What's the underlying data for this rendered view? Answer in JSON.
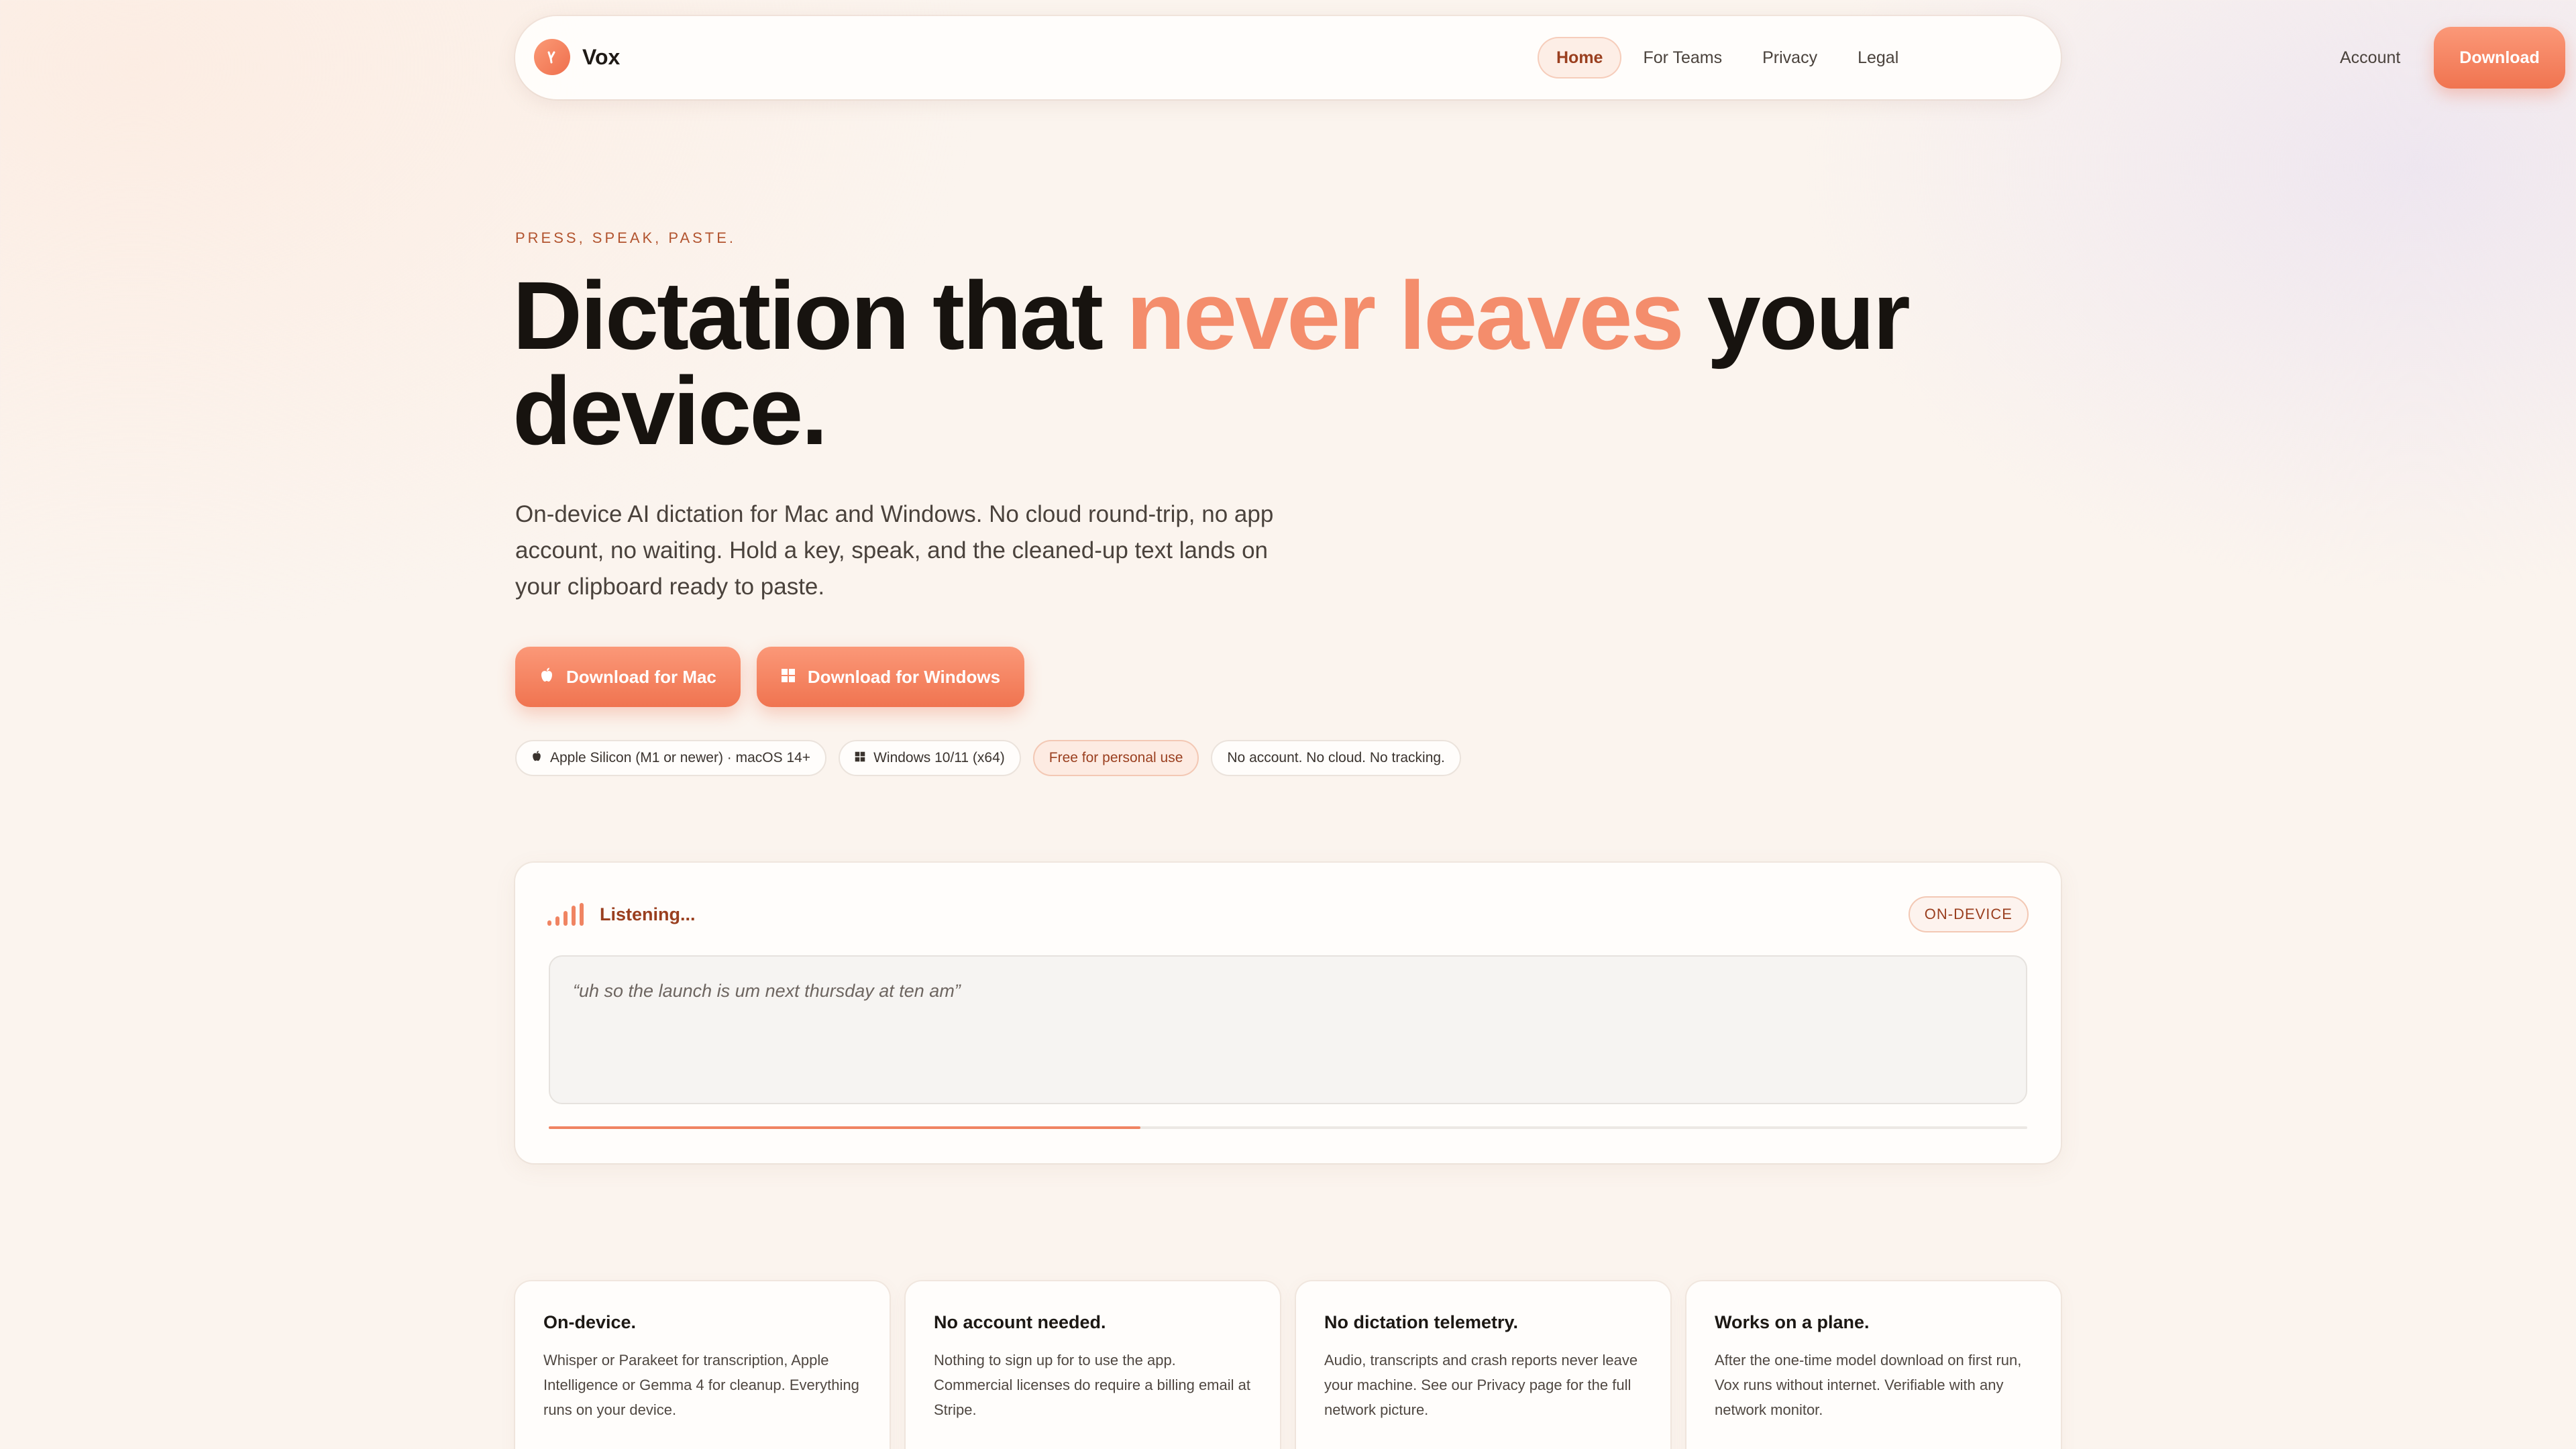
{
  "brand": {
    "name": "Vox"
  },
  "nav": {
    "links": [
      {
        "label": "Home",
        "active": true
      },
      {
        "label": "For Teams",
        "active": false
      },
      {
        "label": "Privacy",
        "active": false
      },
      {
        "label": "Legal",
        "active": false
      }
    ],
    "account": "Account",
    "download": "Download"
  },
  "hero": {
    "eyebrow": "PRESS, SPEAK, PASTE.",
    "headline_before": "Dictation that ",
    "headline_accent": "never leaves",
    "headline_after": " your device.",
    "subtitle": "On-device AI dictation for Mac and Windows. No cloud round-trip, no app account, no waiting. Hold a key, speak, and the cleaned-up text lands on your clipboard ready to paste.",
    "cta_mac": "Download for Mac",
    "cta_windows": "Download for Windows",
    "chips": [
      {
        "label": "Apple Silicon (M1 or newer) · macOS 14+",
        "icon": "apple-icon"
      },
      {
        "label": "Windows 10/11 (x64)",
        "icon": "windows-icon"
      },
      {
        "label": "Free for personal use",
        "icon": ""
      },
      {
        "label": "No account. No cloud. No tracking.",
        "icon": ""
      }
    ]
  },
  "demo": {
    "status": "Listening...",
    "badge": "ON-DEVICE",
    "transcript": "“uh so the launch is um next thursday at ten am”",
    "progress": 0.4
  },
  "features": [
    {
      "title": "On-device.",
      "body": "Whisper or Parakeet for transcription, Apple Intelligence or Gemma 4 for cleanup. Everything runs on your device."
    },
    {
      "title": "No account needed.",
      "body": "Nothing to sign up for to use the app. Commercial licenses do require a billing email at Stripe."
    },
    {
      "title": "No dictation telemetry.",
      "body": "Audio, transcripts and crash reports never leave your machine. See our Privacy page for the full network picture."
    },
    {
      "title": "Works on a plane.",
      "body": "After the one-time model download on first run, Vox runs without internet. Verifiable with any network monitor."
    }
  ],
  "colors": {
    "accent": "#f07450",
    "accent_light": "#f48d6c",
    "accent_text": "#9a3f1f",
    "background": "#fbf4ee"
  }
}
